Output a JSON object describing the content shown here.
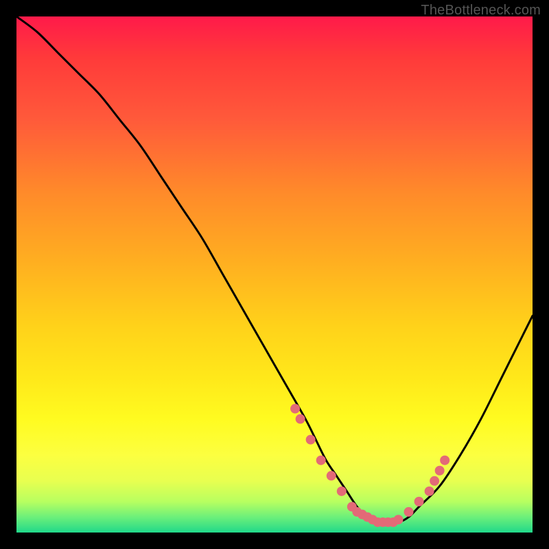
{
  "watermark": "TheBottleneck.com",
  "chart_data": {
    "type": "line",
    "title": "",
    "xlabel": "",
    "ylabel": "",
    "xlim": [
      0,
      100
    ],
    "ylim": [
      0,
      100
    ],
    "grid": false,
    "series": [
      {
        "name": "bottleneck-curve",
        "x": [
          0,
          4,
          8,
          12,
          16,
          20,
          24,
          28,
          32,
          36,
          40,
          44,
          48,
          52,
          56,
          58,
          60,
          62,
          64,
          66,
          68,
          70,
          72,
          74,
          76,
          78,
          82,
          86,
          90,
          94,
          98,
          100
        ],
        "values": [
          100,
          97,
          93,
          89,
          85,
          80,
          75,
          69,
          63,
          57,
          50,
          43,
          36,
          29,
          22,
          18,
          14,
          11,
          8,
          5,
          3,
          2,
          2,
          2,
          3,
          5,
          9,
          15,
          22,
          30,
          38,
          42
        ]
      }
    ],
    "markers": {
      "name": "highlight-dots",
      "color": "#e36a77",
      "x": [
        54,
        55,
        57,
        59,
        61,
        63,
        65,
        66,
        67,
        68,
        69,
        70,
        71,
        72,
        73,
        74,
        76,
        78,
        80,
        81,
        82,
        83
      ],
      "values": [
        24,
        22,
        18,
        14,
        11,
        8,
        5,
        4,
        3.5,
        3,
        2.5,
        2,
        2,
        2,
        2,
        2.5,
        4,
        6,
        8,
        10,
        12,
        14
      ]
    }
  }
}
